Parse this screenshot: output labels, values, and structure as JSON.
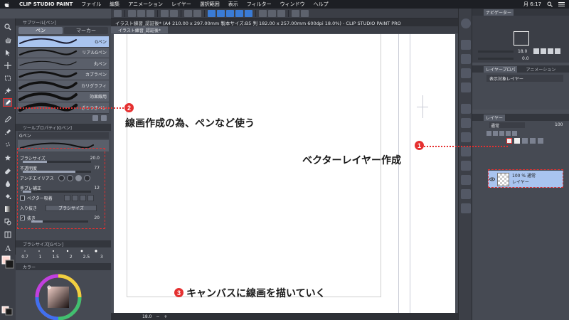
{
  "menubar": {
    "items": [
      "CLIP STUDIO PAINT",
      "ファイル",
      "編集",
      "アニメーション",
      "レイヤー",
      "選択範囲",
      "表示",
      "フィルター",
      "ウィンドウ",
      "ヘルプ"
    ],
    "clock": "月 6:17"
  },
  "subtool": {
    "title": "サブツール[ペン]",
    "tabs": [
      "ペン",
      "マーカー"
    ],
    "brushes": [
      "Gペン",
      "リアルGペン",
      "丸ペン",
      "カブラペン",
      "カリグラフィ",
      "効果線用",
      "ざらつきペン"
    ]
  },
  "toolprop": {
    "title": "ツールプロパティ[Gペン]",
    "name": "Gペン",
    "rows": {
      "brush_size": {
        "label": "ブラシサイズ",
        "value": "20.0",
        "level": 0.35
      },
      "opacity": {
        "label": "不透明度",
        "value": "77",
        "level": 0.77
      },
      "antialias": {
        "label": "アンチエイリアス"
      },
      "stabilization": {
        "label": "手ブレ補正",
        "value": "12",
        "level": 0.12
      },
      "vector_snap": {
        "label": "ベクター吸着"
      },
      "taper": {
        "label": "入り抜き",
        "option": "ブラシサイズ"
      },
      "taper_out": {
        "label": "抜き",
        "value": "20",
        "level": 0.2
      }
    }
  },
  "brushsize": {
    "title": "ブラシサイズ[Gペン]",
    "sizes": [
      "0.7",
      "1",
      "1.5",
      "2",
      "2.5",
      "3"
    ]
  },
  "colorpanel": {
    "title": "カラー"
  },
  "document": {
    "title": "イラスト練習_認証後* (A4 210.00 x 297.00mm 製本サイズ:B5 判 182.00 x 257.00mm 600dpi 18.0%) - CLIP STUDIO PAINT PRO",
    "tab": "イラスト練習_認証後*",
    "zoom": "18.0"
  },
  "navigator": {
    "title": "ナビゲーター",
    "zoom": "18.0",
    "angle": "0.0"
  },
  "layerprop": {
    "title": "レイヤープロパ",
    "anim": "アニメーション",
    "effect": "表示対象レイヤー"
  },
  "layers": {
    "title": "レイヤー",
    "blend": "通常",
    "opacity": "100",
    "layer": {
      "line1": "100 % 通常",
      "line2": "レイヤー"
    }
  },
  "callouts": {
    "c1": {
      "num": "1",
      "text": "ベクターレイヤー作成"
    },
    "c2": {
      "num": "2",
      "text": "線画作成の為、ペンなど使う"
    },
    "c3": {
      "num": "3",
      "text": "キャンバスに線画を描いていく"
    }
  },
  "colors": {
    "accent": "#e53030",
    "selection": "#a9c4ef",
    "panel": "#464a53"
  }
}
